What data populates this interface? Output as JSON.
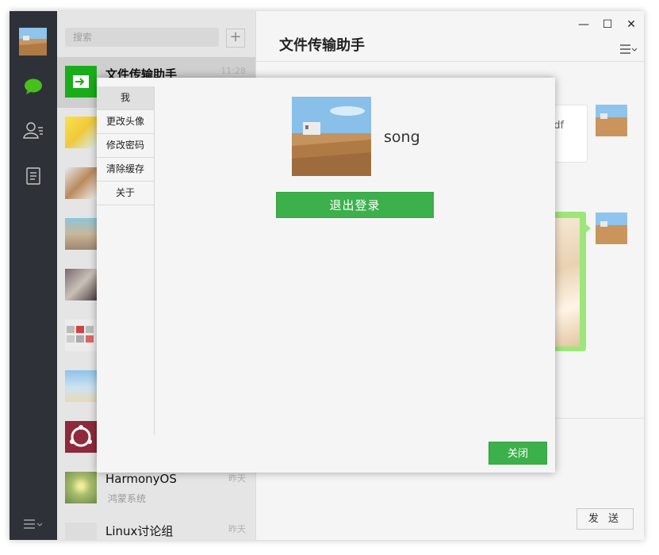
{
  "search": {
    "placeholder": "搜索"
  },
  "chats": [
    {
      "name": "文件传输助手",
      "time": "11:28",
      "subtitle": ""
    },
    {
      "name": "",
      "time": "",
      "subtitle": ""
    },
    {
      "name": "",
      "time": "",
      "subtitle": ""
    },
    {
      "name": "",
      "time": "",
      "subtitle": ""
    },
    {
      "name": "",
      "time": "",
      "subtitle": ""
    },
    {
      "name": "",
      "time": "",
      "subtitle": ""
    },
    {
      "name": "",
      "time": "",
      "subtitle": ""
    },
    {
      "name": "",
      "time": "",
      "subtitle": ""
    },
    {
      "name": "HarmonyOS",
      "time": "昨天",
      "subtitle": "鸿蒙系统"
    },
    {
      "name": "Linux讨论组",
      "time": "昨天",
      "subtitle": ""
    }
  ],
  "main": {
    "title": "文件传输助手",
    "file_ext": "pdf",
    "send_label": "发 送"
  },
  "dialog": {
    "menu": [
      "我",
      "更改头像",
      "修改密码",
      "清除缓存",
      "关于"
    ],
    "username": "song",
    "logout_label": "退出登录",
    "close_label": "关闭"
  },
  "colors": {
    "accent": "#3cb04b",
    "sidebar": "#2e3238",
    "bubble": "#9de77a"
  }
}
